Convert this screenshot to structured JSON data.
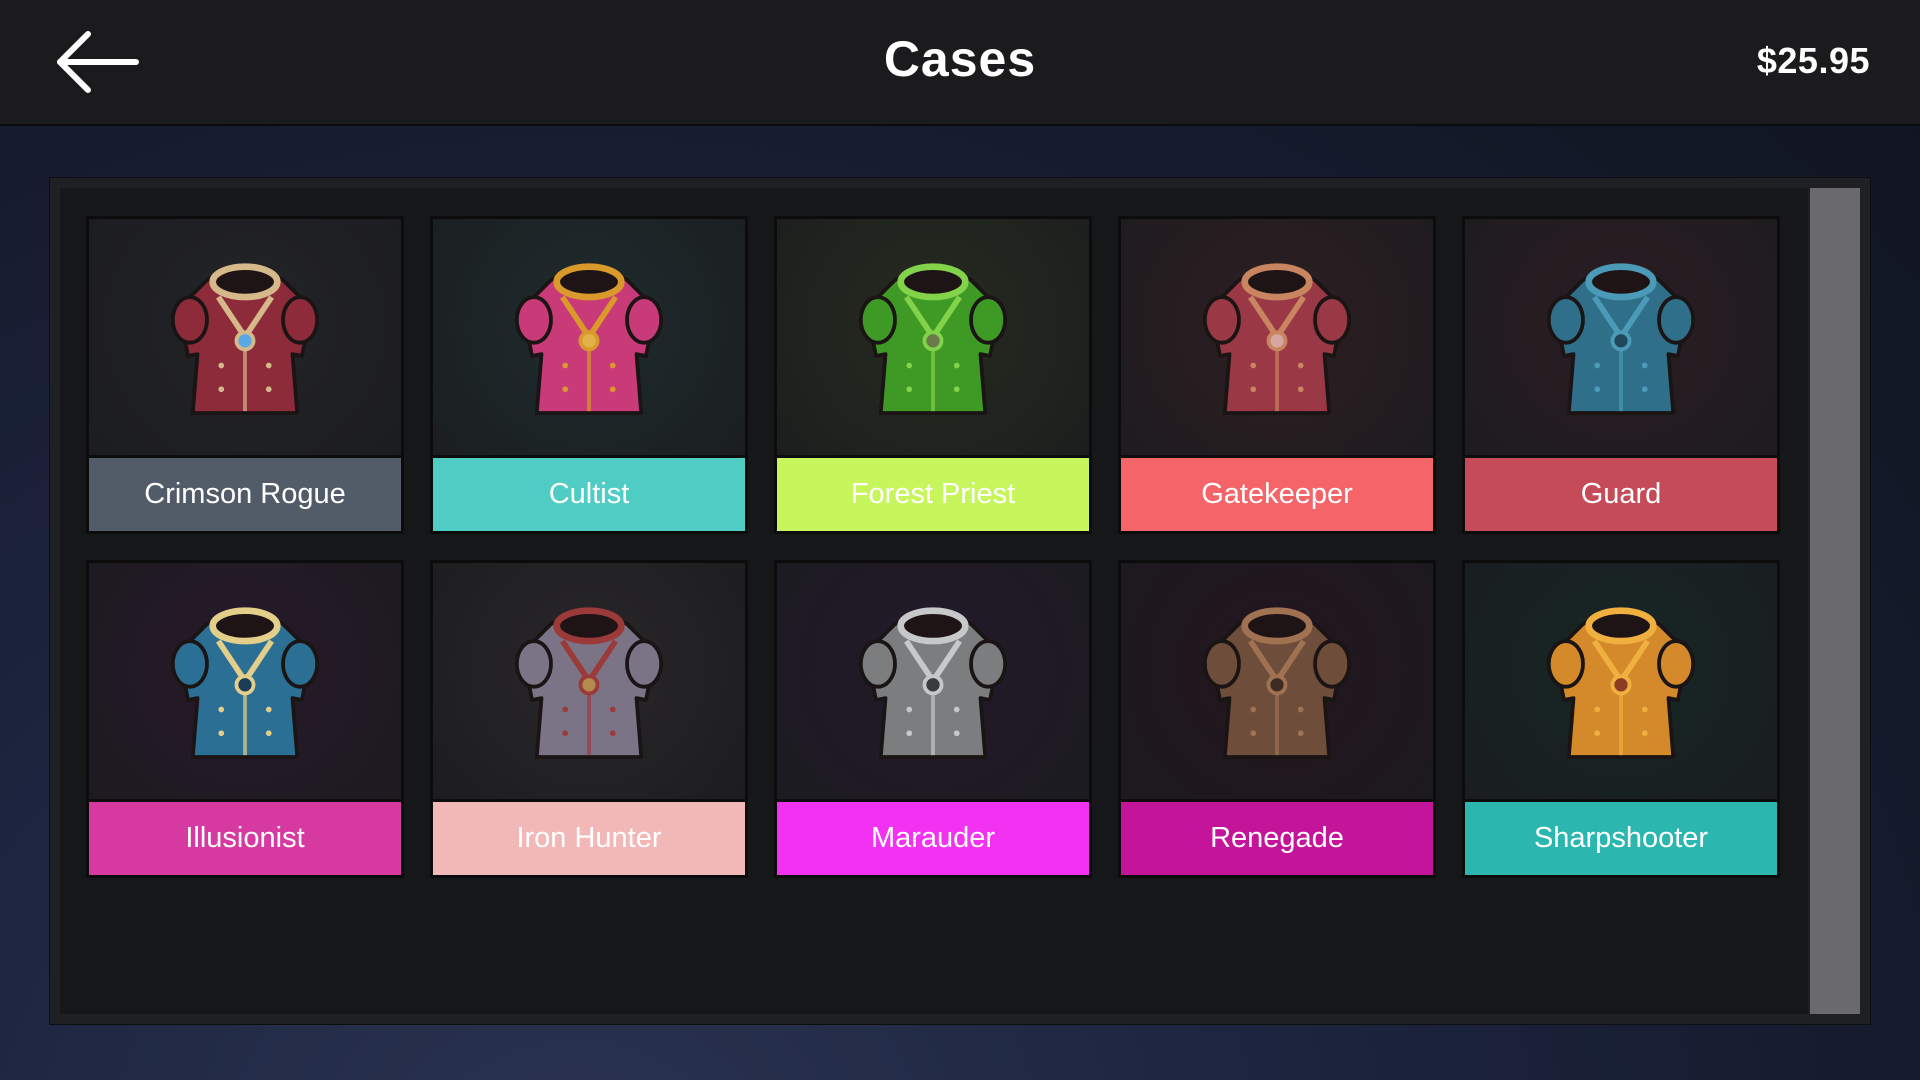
{
  "header": {
    "back_icon": "arrow-left-icon",
    "title": "Cases",
    "balance": "$25.95"
  },
  "cases": [
    {
      "id": "crimson-rogue",
      "label": "Crimson Rogue",
      "label_color": "#525b68",
      "bg": "#232427",
      "armor": "armor-vest-icon",
      "primary": "#8e2b3a",
      "accent": "#d6b98a",
      "gem": "#5aa8e6"
    },
    {
      "id": "cultist",
      "label": "Cultist",
      "label_color": "#4fcdc4",
      "bg": "#1e2c2d",
      "armor": "robe-icon",
      "primary": "#c83b78",
      "accent": "#d99a2b",
      "gem": "#e2b24a"
    },
    {
      "id": "forest-priest",
      "label": "Forest Priest",
      "label_color": "#c6f55c",
      "bg": "#262b1f",
      "armor": "hooded-cloak-icon",
      "primary": "#3f9a25",
      "accent": "#82d24a",
      "gem": "#6b7a4a"
    },
    {
      "id": "gatekeeper",
      "label": "Gatekeeper",
      "label_color": "#f56468",
      "bg": "#2e1f22",
      "armor": "scale-armor-icon",
      "primary": "#9a3845",
      "accent": "#c9855f",
      "gem": "#d5a7a0"
    },
    {
      "id": "guard",
      "label": "Guard",
      "label_color": "#c44b57",
      "bg": "#2b1d22",
      "armor": "plate-armor-icon",
      "primary": "#2f6f8a",
      "accent": "#4b9ab8",
      "gem": "#20475a"
    },
    {
      "id": "illusionist",
      "label": "Illusionist",
      "label_color": "#d63aa0",
      "bg": "#28192a",
      "armor": "winged-armor-icon",
      "primary": "#2b6f95",
      "accent": "#e4cf8a",
      "gem": "#1b3d58"
    },
    {
      "id": "iron-hunter",
      "label": "Iron Hunter",
      "label_color": "#f2b7b7",
      "bg": "#292628",
      "armor": "chainmail-icon",
      "primary": "#7b7486",
      "accent": "#9c3a3a",
      "gem": "#b28b4f"
    },
    {
      "id": "marauder",
      "label": "Marauder",
      "label_color": "#f331f2",
      "bg": "#231a2b",
      "armor": "spiked-plate-icon",
      "primary": "#7c7d7f",
      "accent": "#c7c8ca",
      "gem": "#3a3b3d"
    },
    {
      "id": "renegade",
      "label": "Renegade",
      "label_color": "#c4159a",
      "bg": "#24151f",
      "armor": "leather-armor-icon",
      "primary": "#6e4e3a",
      "accent": "#a07252",
      "gem": "#3e2c22"
    },
    {
      "id": "sharpshooter",
      "label": "Sharpshooter",
      "label_color": "#2bb6b0",
      "bg": "#172726",
      "armor": "jacket-icon",
      "primary": "#d48a2a",
      "accent": "#f0b040",
      "gem": "#8c3c22"
    }
  ]
}
